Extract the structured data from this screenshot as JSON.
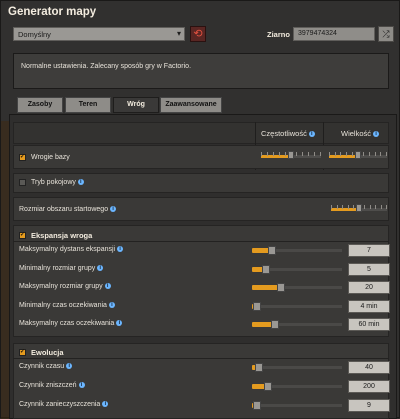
{
  "window": {
    "title": "Generator mapy"
  },
  "preset": {
    "selected": "Domyślny"
  },
  "seed": {
    "label": "Ziarno",
    "value": "3979474324"
  },
  "description": "Normalne ustawienia. Zalecany sposób gry w Factorio.",
  "tabs": [
    {
      "label": "Zasoby"
    },
    {
      "label": "Teren"
    },
    {
      "label": "Wróg",
      "active": true
    },
    {
      "label": "Zaawansowane"
    }
  ],
  "columns": {
    "frequency": "Częstotliwość",
    "size": "Wielkość"
  },
  "enemy_bases": {
    "label": "Wrogie bazy",
    "checked": true,
    "frequency_level": 0.5,
    "size_level": 0.5
  },
  "peaceful": {
    "label": "Tryb pokojowy",
    "checked": false
  },
  "starting_area": {
    "label": "Rozmiar obszaru startowego",
    "level": 0.5
  },
  "expansion": {
    "title": "Ekspansja wroga",
    "checked": true,
    "rows": [
      {
        "label": "Maksymalny dystans ekspansji",
        "value": "7",
        "fraction": 0.22
      },
      {
        "label": "Minimalny rozmiar grupy",
        "value": "5",
        "fraction": 0.16
      },
      {
        "label": "Maksymalny rozmiar grupy",
        "value": "20",
        "fraction": 0.32
      },
      {
        "label": "Minimalny czas oczekiwania",
        "value": "4 min",
        "fraction": 0.06
      },
      {
        "label": "Maksymalny czas oczekiwania",
        "value": "60 min",
        "fraction": 0.26
      }
    ]
  },
  "evolution": {
    "title": "Ewolucja",
    "checked": true,
    "rows": [
      {
        "label": "Czynnik czasu",
        "value": "40",
        "fraction": 0.08
      },
      {
        "label": "Czynnik zniszczeń",
        "value": "200",
        "fraction": 0.18
      },
      {
        "label": "Czynnik zanieczyszczenia",
        "value": "9",
        "fraction": 0.05
      }
    ]
  },
  "colors": {
    "accent": "#e49b1f",
    "info": "#6bb6ff",
    "reset": "#e0503f"
  }
}
